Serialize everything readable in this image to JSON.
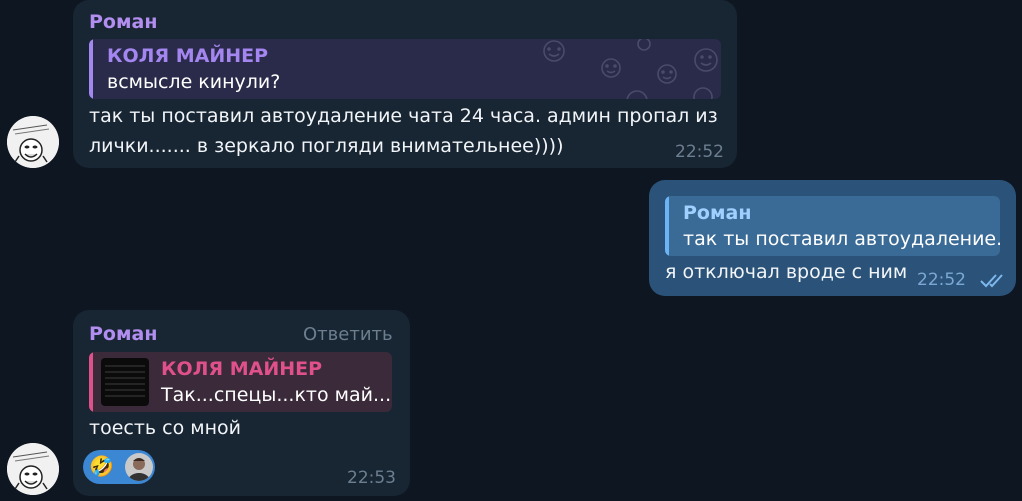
{
  "messages": [
    {
      "sender": "Роман",
      "reply": {
        "name": "КОЛЯ МАЙНЕР",
        "text": "всмысле кинули?"
      },
      "text_line1": "так ты поставил автоудаление чата 24 часа. админ пропал из",
      "text_line2": "лички....... в зеркало погляди внимательнее))))",
      "time": "22:52"
    },
    {
      "reply": {
        "name": "Роман",
        "text": "так ты поставил автоудаление..."
      },
      "text": "я отключал вроде с ним",
      "time": "22:52"
    },
    {
      "sender": "Роман",
      "reply_action": "Ответить",
      "reply": {
        "name": "КОЛЯ МАЙНЕР",
        "text": "Так...спецы...кто май..."
      },
      "text": "тоесть со мной",
      "reaction_emoji": "🤣",
      "time": "22:53"
    }
  ],
  "colors": {
    "background": "#0e1621",
    "incoming_bubble": "#182533",
    "outgoing_bubble": "#2b5278",
    "sender_name": "#b18eef",
    "quote_purple": "#a486f0",
    "quote_pink": "#e0508a",
    "quote_blue": "#6cb4f5"
  }
}
